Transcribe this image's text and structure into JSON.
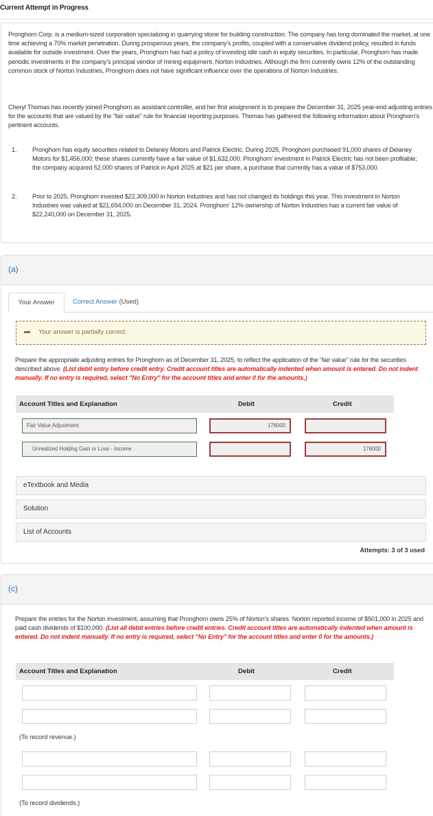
{
  "header": {
    "title": "Current Attempt in Progress"
  },
  "problem": {
    "paragraphs": [
      "Pronghorn Corp. is a medium-sized corporation specializing in quarrying stone for building construction. The company has long dominated the market, at one time achieving a 70% market penetration. During prosperous years, the company’s profits, coupled with a conservative dividend policy, resulted in funds available for outside investment. Over the years, Pronghorn has had a policy of investing idle cash in equity securities. In particular, Pronghorn has made periodic investments in the company’s principal vendor of mining equipment, Norton Industries. Although the firm currently owns 12% of the outstanding common stock of Norton Industries, Pronghorn does not have significant influence over the operations of Norton Industries.",
      "Cheryl Thomas has recently joined Pronghorn as assistant controller, and her first assignment is to prepare the December 31, 2025 year-end adjusting entries for the accounts that are valued by the “fair value” rule for financial reporting purposes. Thomas has gathered the following information about Pronghorn’s pertinent accounts."
    ],
    "list": [
      {
        "num": "1.",
        "text": "Pronghorn has equity securities related to Delaney Motors and Patrick Electric. During 2025, Pronghorn purchased 91,000 shares of Delaney Motors for $1,456,000; these shares currently have a fair value of $1,632,000. Pronghorn’ investment in Patrick Electric has not been profitable; the company acquired 52,000 shares of Patrick in April 2025 at $21 per share, a purchase that currently has a value of $753,000."
      },
      {
        "num": "2.",
        "text": "Prior to 2025, Pronghorn invested $22,309,000 in Norton Industries and has not changed its holdings this year. This investment in Norton Industries was valued at $21,694,000 on December 31, 2024. Pronghorn’ 12% ownership of Norton Industries has a current fair value of $22,240,000 on December 31, 2025."
      }
    ]
  },
  "part_a": {
    "label": "(a)",
    "tabs": {
      "your_answer": "Your Answer",
      "correct_answer_link": "Correct Answer",
      "correct_answer_suffix": " (Used)"
    },
    "feedback": {
      "icon": "minus-icon",
      "message": "Your answer is partially correct.",
      "color": "#8a6d3b"
    },
    "instruction_plain": "Prepare the appropriate adjusting entries for Pronghorn as of December 31, 2025, to reflect the application of the “fair value” rule for the securities described above. ",
    "instruction_red": "(List debit entry before credit entry. Credit account titles are automatically indented when amount is entered. Do not indent manually. If no entry is required, select \"No Entry\" for the account titles and enter 0 for the amounts.)",
    "table_headers": {
      "title": "Account Titles and Explanation",
      "debit": "Debit",
      "credit": "Credit"
    },
    "rows": [
      {
        "title": "Fair Value Adjustment",
        "debit": "176000",
        "credit": ""
      },
      {
        "title": "Unrealized Holding Gain or Loss - Income",
        "debit": "",
        "credit": "176000"
      }
    ],
    "resources": [
      "eTextbook and Media",
      "Solution",
      "List of Accounts"
    ],
    "attempts": "Attempts: 3 of 3 used"
  },
  "part_c": {
    "label": "(c)",
    "instruction_plain": "Prepare the entries for the Norton investment, assuming that Pronghorn owns 25% of Norton’s shares. Norton reported income of $501,000 in 2025 and paid cash dividends of $100,000. ",
    "instruction_red": "(List all debit entries before credit entries. Credit account titles are automatically indented when amount is entered. Do not indent manually. If no entry is required, select \"No Entry\" for the account titles and enter 0 for the amounts.)",
    "table_headers": {
      "title": "Account Titles and Explanation",
      "debit": "Debit",
      "credit": "Credit"
    },
    "rows": [
      {
        "title": "",
        "debit": "",
        "credit": ""
      },
      {
        "title": "",
        "debit": "",
        "credit": ""
      },
      {
        "title": "",
        "debit": "",
        "credit": ""
      },
      {
        "title": "",
        "debit": "",
        "credit": ""
      }
    ],
    "memos": [
      "(To record revenue.)",
      "(To record dividends.)"
    ]
  },
  "colors": {
    "link": "#2f6fa8",
    "instruction_red": "#e02020",
    "correct_border": "#3e7b3e",
    "incorrect_border": "#9c3c3c"
  }
}
